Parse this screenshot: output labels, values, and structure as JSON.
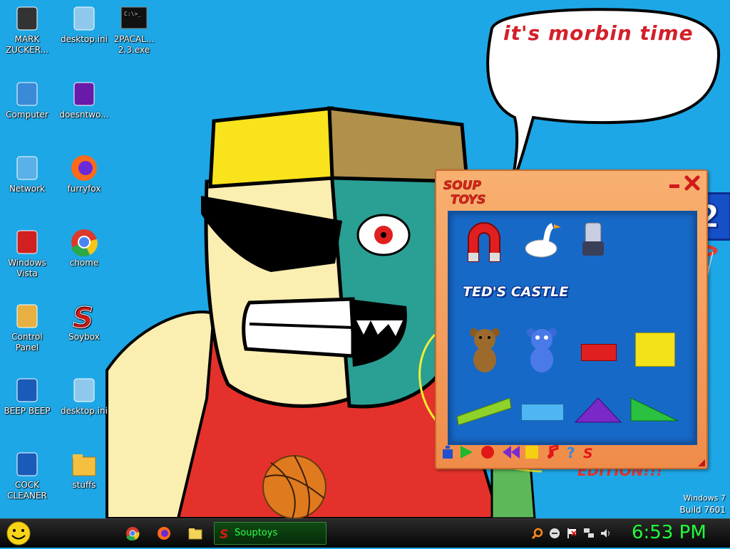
{
  "desktop": {
    "icons": [
      {
        "label": "MARK ZUCKER...",
        "icon": "person-icon"
      },
      {
        "label": "desktop.ini",
        "icon": "settings-file-icon"
      },
      {
        "label": "2PACAL... 2.3.exe",
        "icon": "console-app-icon"
      },
      {
        "label": "Computer",
        "icon": "computer-icon"
      },
      {
        "label": "doesntwo...",
        "icon": "yahoo-messenger-icon"
      },
      {
        "label": "Network",
        "icon": "network-icon"
      },
      {
        "label": "furryfox",
        "icon": "firefox-icon"
      },
      {
        "label": "Windows Vista",
        "icon": "recycle-bin-icon"
      },
      {
        "label": "chome",
        "icon": "chrome-icon"
      },
      {
        "label": "Control Panel",
        "icon": "control-panel-icon"
      },
      {
        "label": "Soybox",
        "icon": "soupbox-icon"
      },
      {
        "label": "BEEP BEEP",
        "icon": "blue-document-icon"
      },
      {
        "label": "desktop.ini",
        "icon": "settings-file-icon"
      },
      {
        "label": "COCK CLEANER",
        "icon": "blue-document-icon"
      },
      {
        "label": "stuffs",
        "icon": "folder-icon"
      }
    ],
    "speech_bubble": "it's morbin time",
    "watermark": {
      "line1": "Windows 7",
      "line2": "Build 7601"
    }
  },
  "souptoys": {
    "logo": "SOUP TOYS",
    "score": "0002",
    "level_label": "TED'S CASTLE",
    "accent": "#f08c4a",
    "play_bg": "#1769c8",
    "toys": [
      "magnet-toy",
      "goose-toy",
      "robot-toy",
      "teddy-bear-toy",
      "blue-bear-toy",
      "red-block-toy",
      "yellow-block-toy",
      "green-plank-toy",
      "blue-block-toy",
      "purple-triangle-toy",
      "green-triangle-toy"
    ],
    "toolbar": [
      "info-icon",
      "play-icon",
      "record-icon",
      "rewind-icon",
      "stop-icon",
      "music-icon",
      "help-icon",
      "soup-icon"
    ]
  },
  "taskbar": {
    "task_label": "Souptoys",
    "clock": "6:53 PM",
    "clock_color": "#21ff3a"
  }
}
